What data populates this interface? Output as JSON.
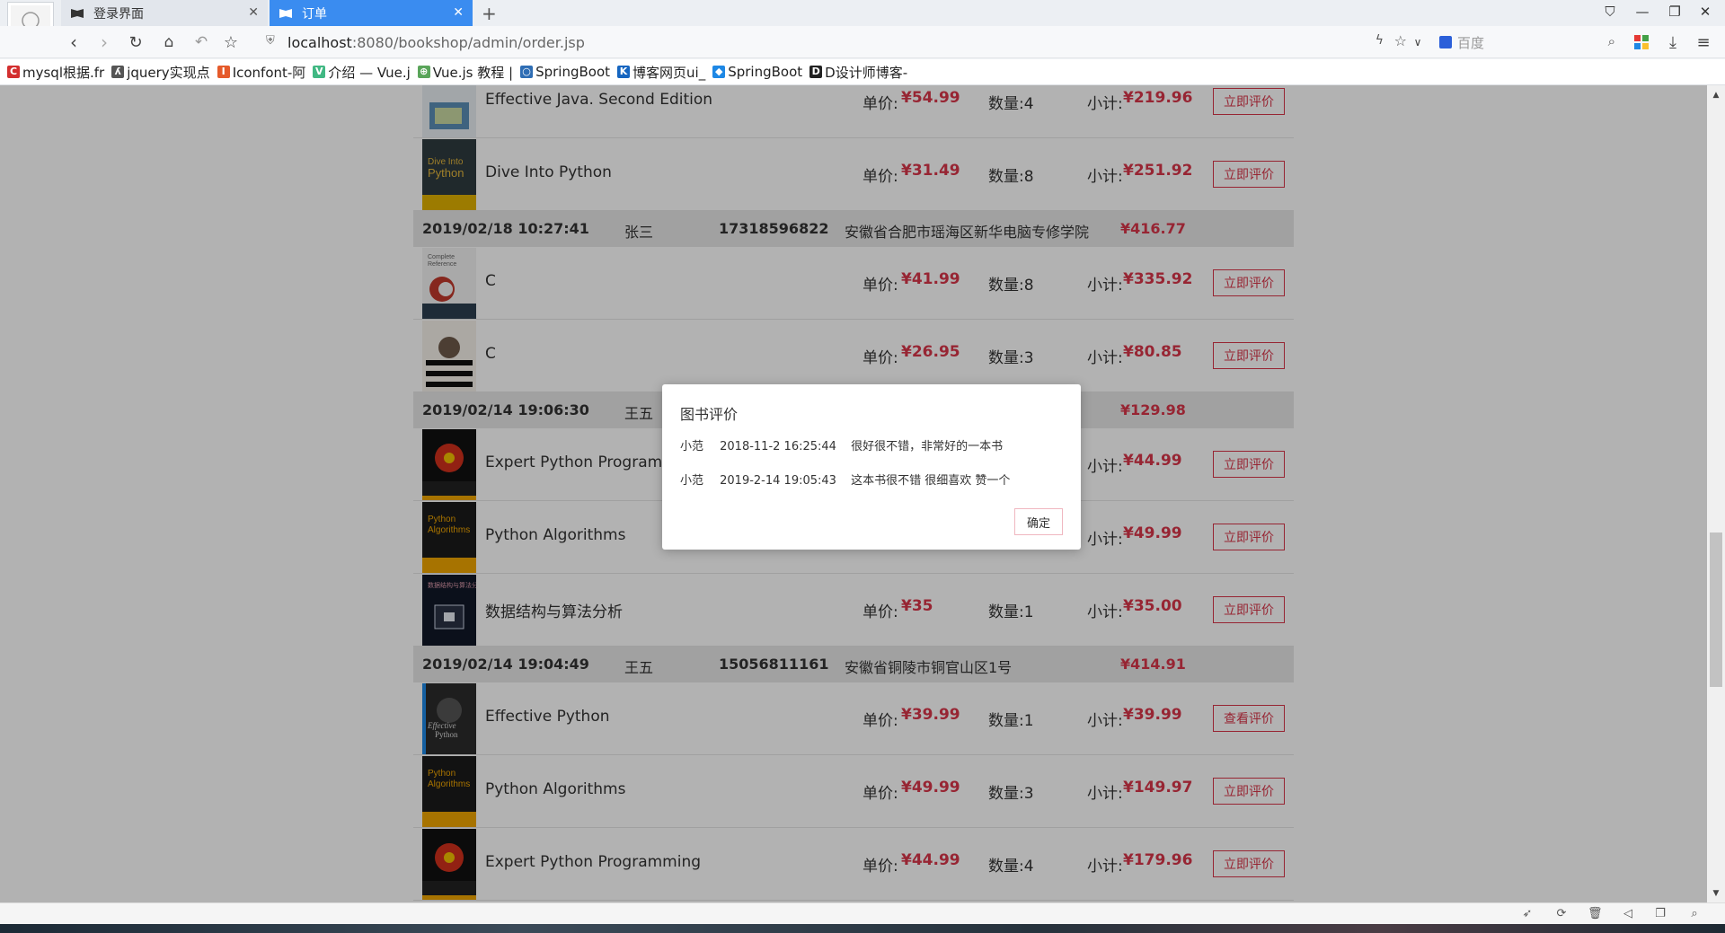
{
  "browser": {
    "tabs": [
      {
        "label": "登录界面"
      },
      {
        "label": "订单"
      }
    ],
    "url_host": "localhost",
    "url_rest": ":8080/bookshop/admin/order.jsp",
    "search_placeholder": "百度",
    "accent_color": "#3a8cf0"
  },
  "bookmarks": [
    {
      "label": "mysql根据.fr",
      "color": "#d32f2f",
      "glyph": "C"
    },
    {
      "label": "jquery实现点",
      "color": "#555555",
      "glyph": "ʎ"
    },
    {
      "label": "Iconfont-阿",
      "color": "#e55a2b",
      "glyph": "I"
    },
    {
      "label": "介绍 — Vue.j",
      "color": "#41b883",
      "glyph": "V"
    },
    {
      "label": "Vue.js 教程 |",
      "color": "#5aa55a",
      "glyph": "⊕"
    },
    {
      "label": "SpringBoot",
      "color": "#2e6db4",
      "glyph": "○"
    },
    {
      "label": "博客网页ui_",
      "color": "#1565c0",
      "glyph": "K"
    },
    {
      "label": "SpringBoot",
      "color": "#1e88e5",
      "glyph": "◆"
    },
    {
      "label": "D设计师博客-",
      "color": "#222222",
      "glyph": "D"
    }
  ],
  "labels": {
    "unit_price": "单价:",
    "subtotal": "小计:"
  },
  "orders_top": [
    {
      "title": "Effective Java. Second Edition",
      "price": "¥54.99",
      "qty": "数量:4",
      "subtotal": "¥219.96",
      "action": "立即评价",
      "cover": "ej"
    },
    {
      "title": "Dive Into Python",
      "price": "¥31.49",
      "qty": "数量:8",
      "subtotal": "¥251.92",
      "action": "立即评价",
      "cover": "dip"
    }
  ],
  "groups": [
    {
      "date": "2019/02/18 10:27:41",
      "name": "张三",
      "phone": "17318596822",
      "address": "安徽省合肥市瑶海区新华电脑专修学院",
      "total": "¥416.77",
      "items": [
        {
          "title": "C",
          "price": "¥41.99",
          "qty": "数量:8",
          "subtotal": "¥335.92",
          "action": "立即评价",
          "cover": "c1"
        },
        {
          "title": "C",
          "price": "¥26.95",
          "qty": "数量:3",
          "subtotal": "¥80.85",
          "action": "立即评价",
          "cover": "c2"
        }
      ]
    },
    {
      "date": "2019/02/14 19:06:30",
      "name": "王五",
      "phone": "",
      "address": "",
      "total": "¥129.98",
      "items": [
        {
          "title": "Expert Python Programmi",
          "price": "",
          "qty": "",
          "subtotal": "¥44.99",
          "action": "立即评价",
          "cover": "epp"
        },
        {
          "title": "Python Algorithms",
          "price": "",
          "qty": "",
          "subtotal": "¥49.99",
          "action": "立即评价",
          "cover": "pa"
        },
        {
          "title": "数据结构与算法分析",
          "price": "¥35",
          "qty": "数量:1",
          "subtotal": "¥35.00",
          "action": "立即评价",
          "cover": "ds"
        }
      ]
    },
    {
      "date": "2019/02/14 19:04:49",
      "name": "王五",
      "phone": "15056811161",
      "address": "安徽省铜陵市铜官山区1号",
      "total": "¥414.91",
      "items": [
        {
          "title": "Effective Python",
          "price": "¥39.99",
          "qty": "数量:1",
          "subtotal": "¥39.99",
          "action": "查看评价",
          "cover": "ep"
        },
        {
          "title": "Python Algorithms",
          "price": "¥49.99",
          "qty": "数量:3",
          "subtotal": "¥149.97",
          "action": "立即评价",
          "cover": "pa"
        },
        {
          "title": "Expert Python Programming",
          "price": "¥44.99",
          "qty": "数量:4",
          "subtotal": "¥179.96",
          "action": "立即评价",
          "cover": "epp"
        }
      ]
    }
  ],
  "modal": {
    "title": "图书评价",
    "reviews": [
      {
        "user": "小范",
        "time": "2018-11-2 16:25:44",
        "text": "很好很不错，非常好的一本书"
      },
      {
        "user": "小范",
        "time": "2019-2-14 19:05:43",
        "text": "这本书很不错 很细喜欢 赞一个"
      }
    ],
    "ok_label": "确定"
  },
  "colors": {
    "price_red": "#d9364a",
    "overlay": "rgba(0,0,0,0.3)"
  }
}
